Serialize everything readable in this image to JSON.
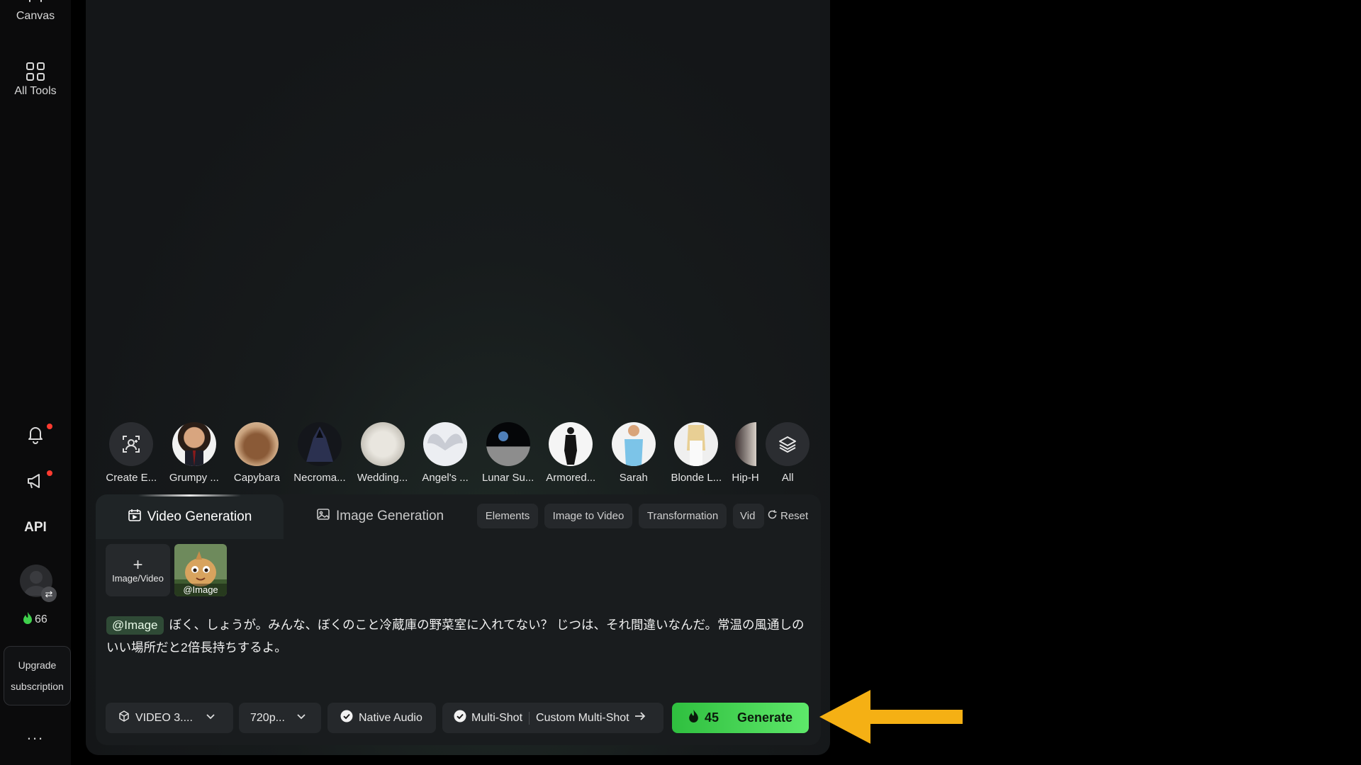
{
  "sidebar": {
    "canvas_label": "Canvas",
    "all_tools_label": "All Tools",
    "api_label": "API",
    "credits": "66",
    "upgrade_line1": "Upgrade",
    "upgrade_line2": "subscription",
    "more": "..."
  },
  "presets": [
    {
      "name": "Create E...",
      "icon": "create-element-icon"
    },
    {
      "name": "Grumpy ..."
    },
    {
      "name": "Capybara"
    },
    {
      "name": "Necroma..."
    },
    {
      "name": "Wedding..."
    },
    {
      "name": "Angel's ..."
    },
    {
      "name": "Lunar Su..."
    },
    {
      "name": "Armored..."
    },
    {
      "name": "Sarah"
    },
    {
      "name": "Blonde L..."
    },
    {
      "name": "Hip-H"
    },
    {
      "name": "All",
      "icon": "layers-icon"
    }
  ],
  "tabs": {
    "video": "Video Generation",
    "image": "Image Generation"
  },
  "chips": [
    "Elements",
    "Image to Video",
    "Transformation",
    "Vid"
  ],
  "reset_label": "Reset",
  "upload": {
    "label": "Image/Video"
  },
  "attachment": {
    "tag": "@Image"
  },
  "prompt": {
    "mention": "@Image",
    "text": "ぼく、しょうが。みんな、ぼくのこと冷蔵庫の野菜室に入れてない？ じつは、それ間違いなんだ。常温の風通しのいい場所だと2倍長持ちするよ。"
  },
  "toolbar": {
    "model": "VIDEO 3....",
    "resolution": "720p...",
    "native_audio": "Native Audio",
    "multi_shot": "Multi-Shot",
    "custom_multi_shot": "Custom Multi-Shot",
    "cost": "45",
    "generate": "Generate"
  },
  "colors": {
    "generate_gradient_start": "#2fbf3f",
    "generate_gradient_end": "#5ee86a",
    "arrow": "#f5b014",
    "notification_dot": "#ff3b30"
  }
}
